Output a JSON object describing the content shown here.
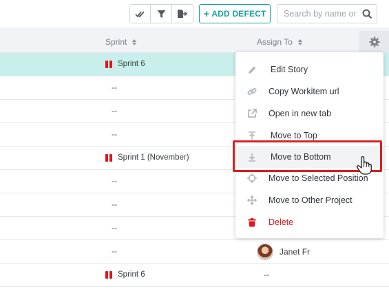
{
  "toolbar": {
    "icons": [
      "double-check-icon",
      "filter-icon",
      "export-icon"
    ],
    "add_defect_label": "ADD DEFECT",
    "search_placeholder": "Search by name or",
    "accent_color": "#17a2a0"
  },
  "table": {
    "columns": [
      {
        "label": "Sprint"
      },
      {
        "label": "Assign To"
      }
    ],
    "rows": [
      {
        "sprint": "Sprint 6",
        "assign": "",
        "selected": true
      },
      {
        "sprint": "--",
        "assign": ""
      },
      {
        "sprint": "--",
        "assign": ""
      },
      {
        "sprint": "--",
        "assign": ""
      },
      {
        "sprint": "Sprint 1 (November)",
        "assign": ""
      },
      {
        "sprint": "--",
        "assign": ""
      },
      {
        "sprint": "--",
        "assign": ""
      },
      {
        "sprint": "--",
        "assign": ""
      },
      {
        "sprint": "--",
        "assign": "Janet Fr"
      },
      {
        "sprint": "Sprint 6",
        "assign": "--"
      }
    ]
  },
  "context_menu": {
    "items": [
      {
        "label": "Edit Story",
        "icon": "pencil-icon"
      },
      {
        "label": "Copy Workitem url",
        "icon": "link-icon"
      },
      {
        "label": "Open in new tab",
        "icon": "external-link-icon"
      },
      {
        "label": "Move to Top",
        "icon": "arrow-to-top-icon"
      },
      {
        "label": "Move to Bottom",
        "icon": "arrow-to-bottom-icon",
        "hovered": true
      },
      {
        "label": "Move to Selected Position",
        "icon": "crosshair-icon"
      },
      {
        "label": "Move to Other Project",
        "icon": "move-arrows-icon"
      },
      {
        "label": "Delete",
        "icon": "trash-icon",
        "color": "#e0161b"
      }
    ]
  },
  "colors": {
    "selected_row": "#c8efeb",
    "sprint_icon": "#e0161b",
    "highlight_border": "#d9201f"
  }
}
